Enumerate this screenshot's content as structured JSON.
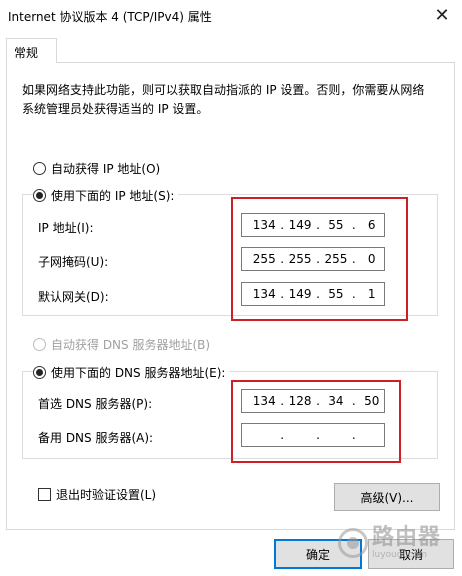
{
  "window": {
    "title": "Internet 协议版本 4 (TCP/IPv4) 属性",
    "close_glyph": "✕"
  },
  "tabs": [
    {
      "label": "常规",
      "active": true
    }
  ],
  "description": "如果网络支持此功能，则可以获取自动指派的 IP 设置。否则，你需要从网络系统管理员处获得适当的 IP 设置。",
  "ip_section": {
    "auto_label": "自动获得 IP 地址(O)",
    "auto_selected": false,
    "manual_label": "使用下面的 IP 地址(S):",
    "manual_selected": true,
    "fields": [
      {
        "label": "IP 地址(I):",
        "octets": [
          "134",
          "149",
          "55",
          "6"
        ]
      },
      {
        "label": "子网掩码(U):",
        "octets": [
          "255",
          "255",
          "255",
          "0"
        ]
      },
      {
        "label": "默认网关(D):",
        "octets": [
          "134",
          "149",
          "55",
          "1"
        ]
      }
    ]
  },
  "dns_section": {
    "auto_label": "自动获得 DNS 服务器地址(B)",
    "auto_enabled": false,
    "manual_label": "使用下面的 DNS 服务器地址(E):",
    "manual_selected": true,
    "fields": [
      {
        "label": "首选 DNS 服务器(P):",
        "octets": [
          "134",
          "128",
          "34",
          "50"
        ]
      },
      {
        "label": "备用 DNS 服务器(A):",
        "octets": [
          "",
          "",
          "",
          ""
        ]
      }
    ]
  },
  "validate_checkbox": {
    "label": "退出时验证设置(L)",
    "checked": false
  },
  "buttons": {
    "advanced": "高级(V)...",
    "ok": "确定",
    "cancel": "取消"
  },
  "watermark": {
    "main": "路由器",
    "sub": "luyouqi.com"
  },
  "colors": {
    "highlight": "#cc1f26",
    "focus_border": "#0078d7",
    "button_face": "#e1e1e1"
  },
  "icons": {
    "close": "close-icon",
    "radio_checked": "radio-checked",
    "radio_unchecked": "radio-unchecked",
    "checkbox_unchecked": "checkbox-unchecked"
  }
}
